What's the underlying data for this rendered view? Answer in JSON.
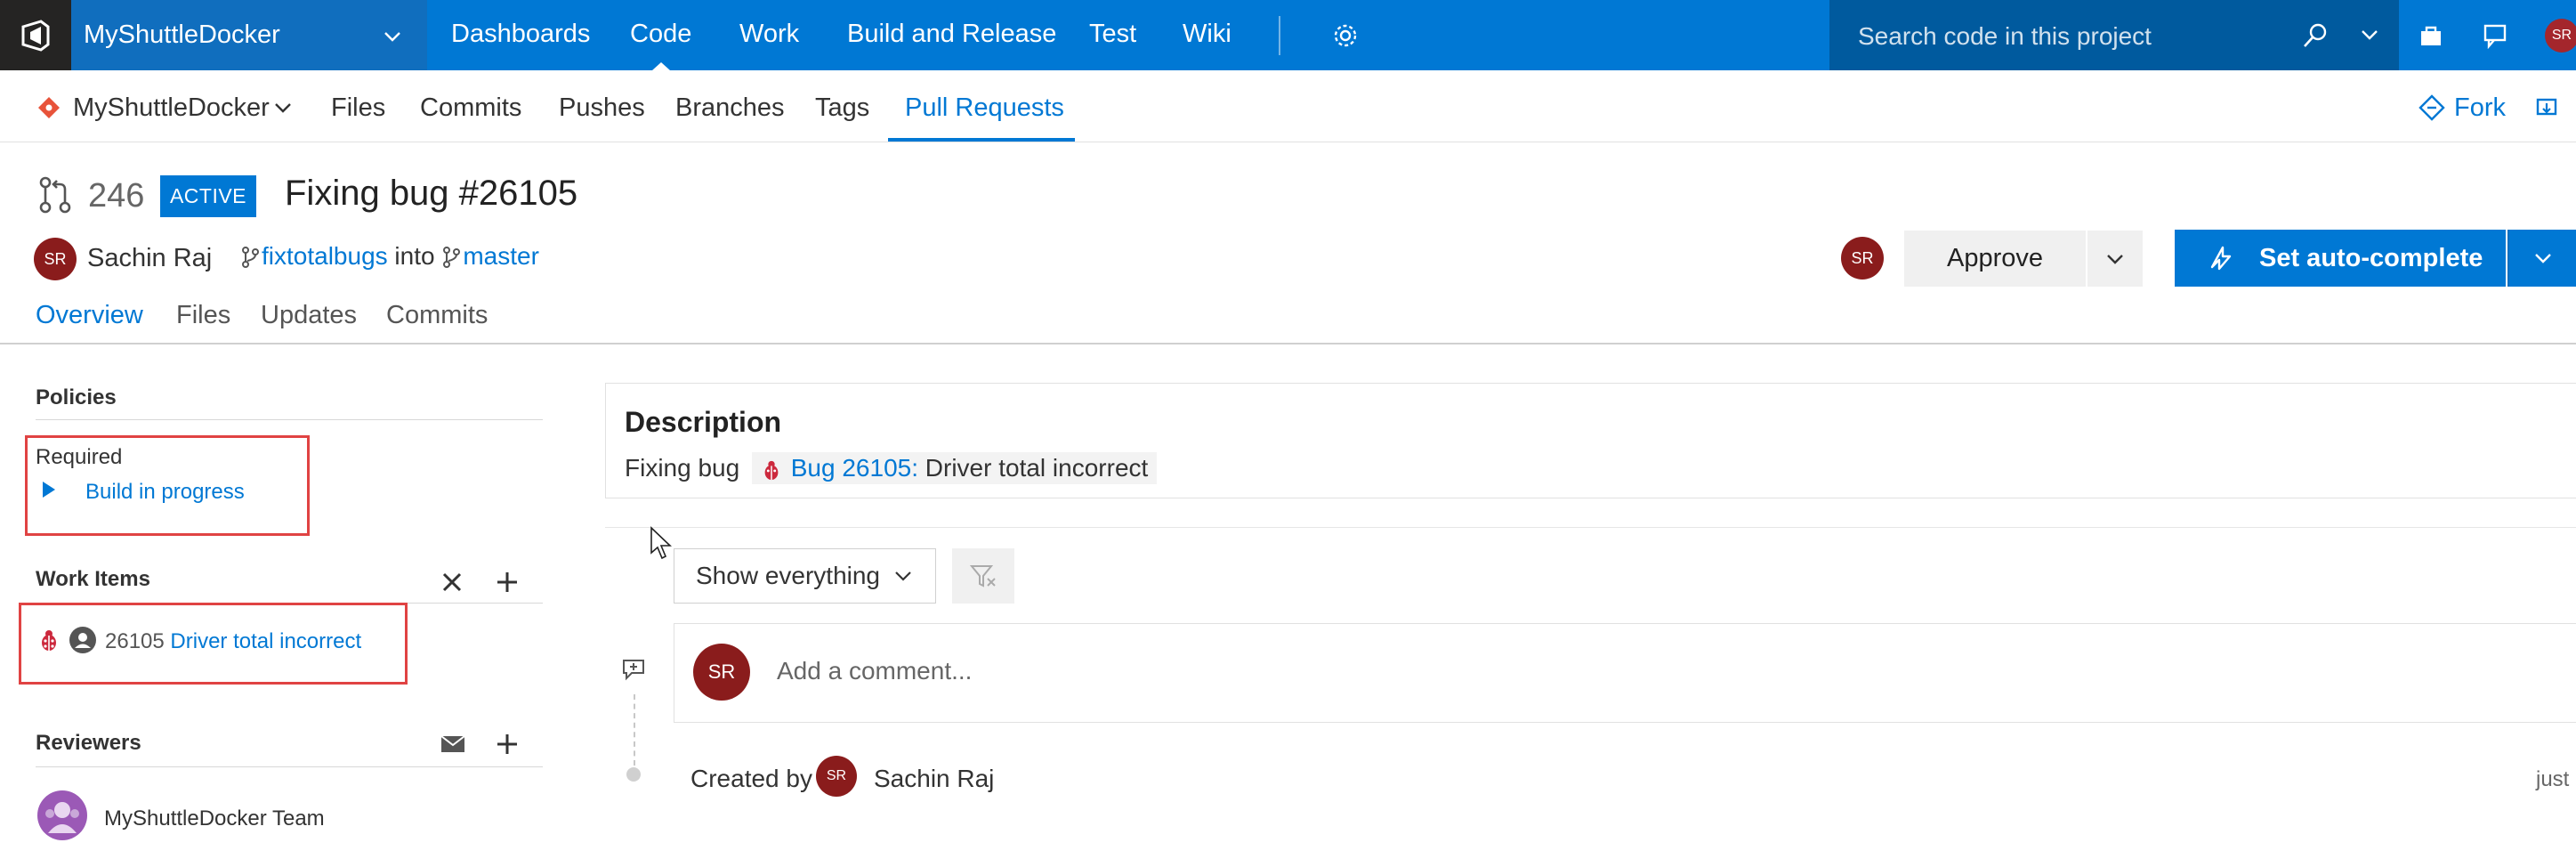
{
  "topbar": {
    "project": "MyShuttleDocker",
    "nav": [
      "Dashboards",
      "Code",
      "Work",
      "Build and Release",
      "Test",
      "Wiki"
    ],
    "active_nav": "Code",
    "search_placeholder": "Search code in this project",
    "user_initials": "SR"
  },
  "subbar": {
    "repo": "MyShuttleDocker",
    "tabs": [
      "Files",
      "Commits",
      "Pushes",
      "Branches",
      "Tags",
      "Pull Requests"
    ],
    "active_tab": "Pull Requests",
    "fork_label": "Fork"
  },
  "pr": {
    "id": "246",
    "status": "ACTIVE",
    "title": "Fixing bug #26105",
    "author_initials": "SR",
    "author": "Sachin Raj",
    "source_branch": "fixtotalbugs",
    "into_label": "into",
    "target_branch": "master",
    "tabs": [
      "Overview",
      "Files",
      "Updates",
      "Commits"
    ],
    "active_tab": "Overview",
    "approve_label": "Approve",
    "autocomplete_label": "Set auto-complete",
    "reviewer_initials": "SR"
  },
  "left": {
    "policies_title": "Policies",
    "required_label": "Required",
    "build_status": "Build in progress",
    "work_items_title": "Work Items",
    "work_item_id": "26105",
    "work_item_title": "Driver total incorrect",
    "reviewers_title": "Reviewers",
    "reviewer_name": "MyShuttleDocker Team"
  },
  "main": {
    "description_title": "Description",
    "description_text": "Fixing bug",
    "bug_ref": "Bug 26105:",
    "bug_title": "Driver total incorrect",
    "filter_label": "Show everything",
    "comment_initials": "SR",
    "comment_placeholder": "Add a comment...",
    "created_by_label": "Created by",
    "created_initials": "SR",
    "created_by": "Sachin Raj",
    "created_time": "just"
  },
  "colors": {
    "accent": "#0078d4",
    "topbar_dark": "#252423",
    "avatar_red": "#8a1c1c",
    "highlight_box": "#e04343"
  }
}
